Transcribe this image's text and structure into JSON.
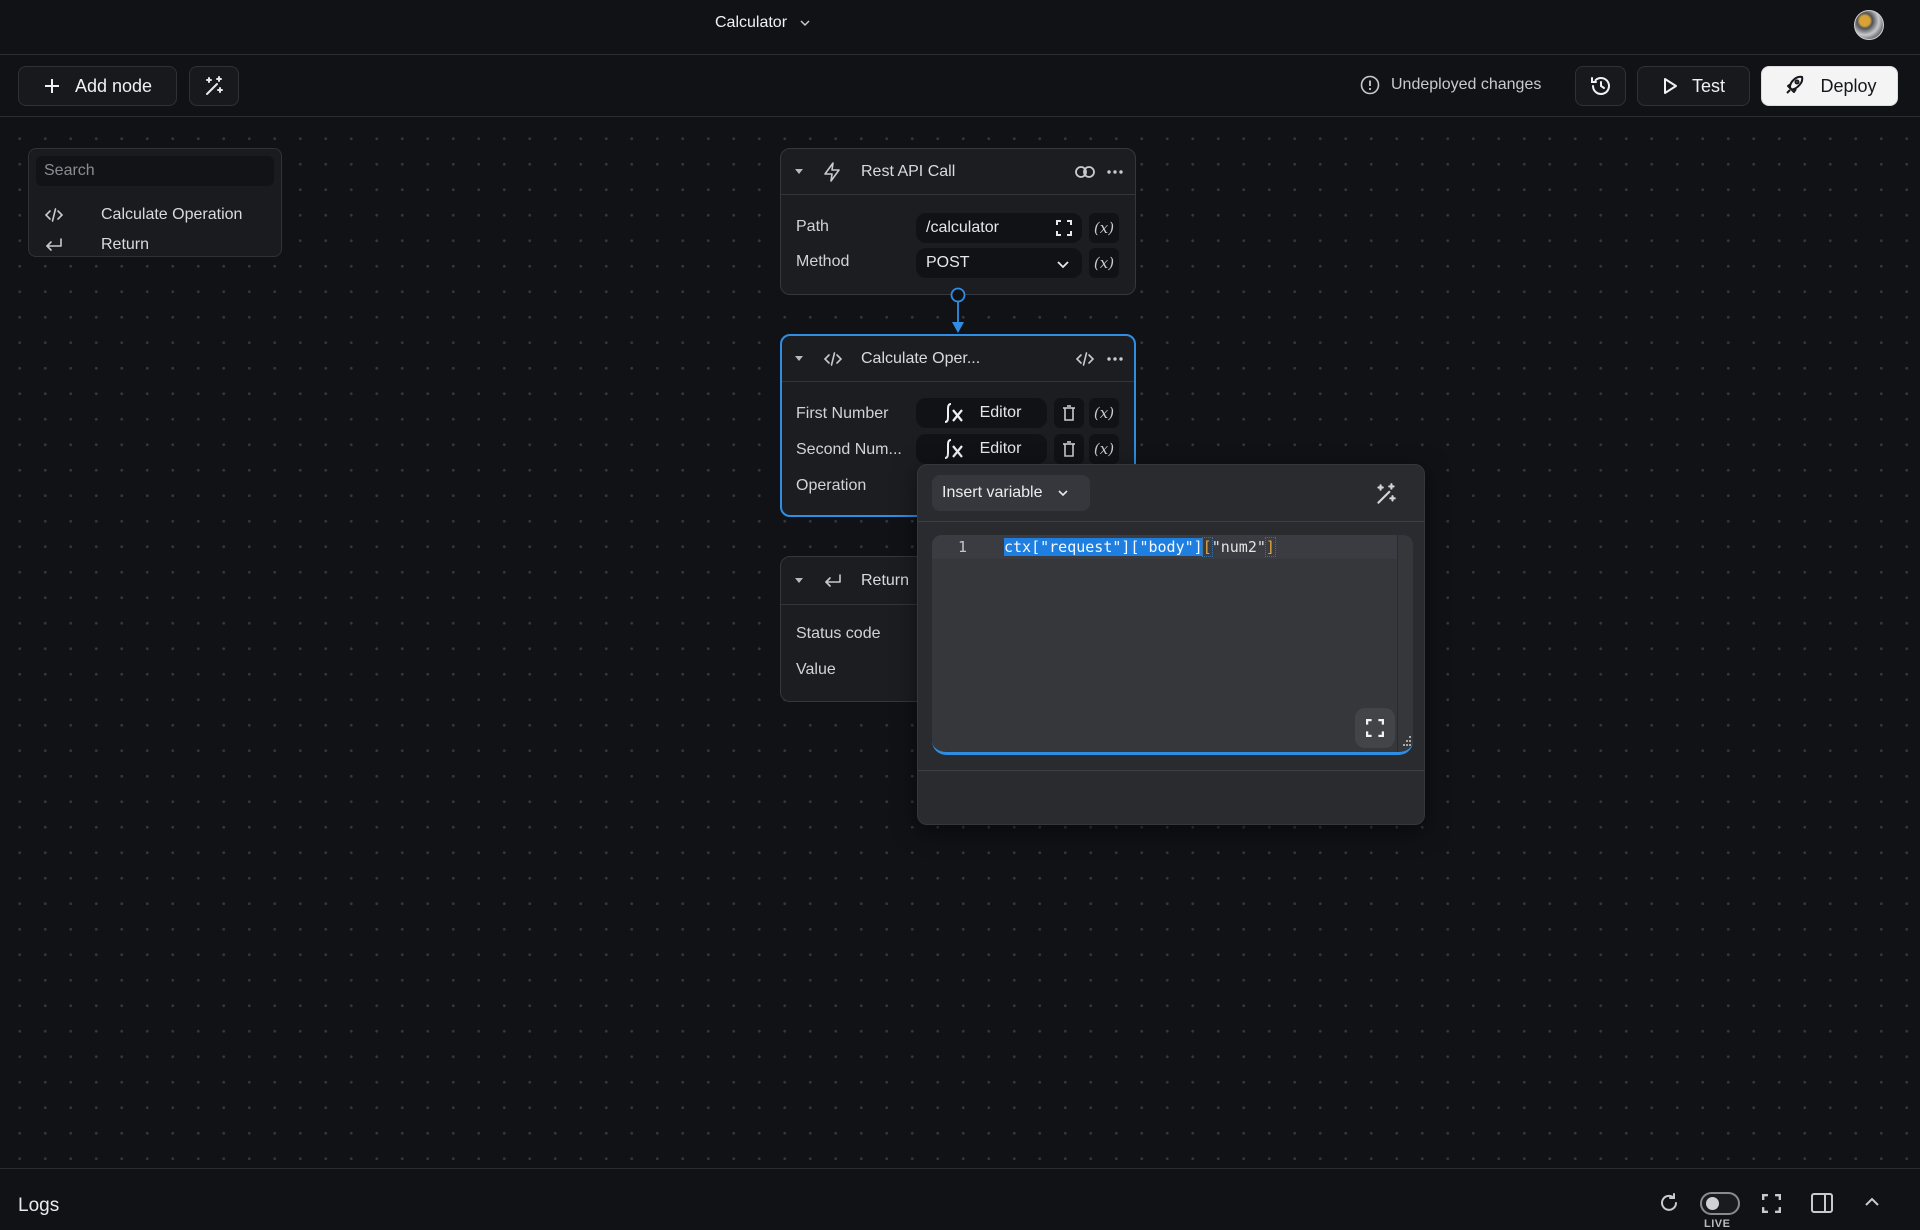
{
  "header": {
    "app_title": "Calculator",
    "avatar_icon": "user-avatar"
  },
  "toolbar": {
    "add_node_label": "Add node",
    "status_text": "Undeployed changes",
    "test_label": "Test",
    "deploy_label": "Deploy",
    "icons": [
      "plus-icon",
      "magic-wand-icon",
      "alert-circle-icon",
      "history-icon",
      "play-icon",
      "rocket-icon"
    ]
  },
  "node_list": {
    "search_placeholder": "Search",
    "items": [
      {
        "label": "Calculate Operation",
        "icon": "code-icon"
      },
      {
        "label": "Return",
        "icon": "return-icon"
      }
    ]
  },
  "nodes": {
    "rest_api": {
      "title": "Rest API Call",
      "icon": "lightning-icon",
      "fields": [
        {
          "label": "Path",
          "value": "/calculator",
          "x_label": "(x)"
        },
        {
          "label": "Method",
          "value": "POST",
          "x_label": "(x)"
        }
      ]
    },
    "calculate": {
      "title": "Calculate Oper...",
      "icon": "code-icon",
      "fields": [
        {
          "label": "First Number",
          "value": "Editor",
          "x_label": "(x)"
        },
        {
          "label": "Second Num...",
          "value": "Editor",
          "x_label": "(x)"
        },
        {
          "label": "Operation"
        }
      ]
    },
    "return": {
      "title": "Return",
      "icon": "return-icon",
      "fields": [
        {
          "label": "Status code"
        },
        {
          "label": "Value"
        }
      ]
    }
  },
  "editor_popup": {
    "insert_variable_label": "Insert variable",
    "line_number": "1",
    "code_selected": "ctx[\"request\"][\"body\"]",
    "code_bracket_open": "[",
    "code_rest": "\"num2\"",
    "code_bracket_close": "]"
  },
  "logs_bar": {
    "title": "Logs",
    "live_label": "LIVE",
    "live_enabled": false
  },
  "colors": {
    "accent": "#2f8de4",
    "background": "#111216",
    "selection": "#1e7fe0",
    "bracket_match": "#e2a63c"
  }
}
